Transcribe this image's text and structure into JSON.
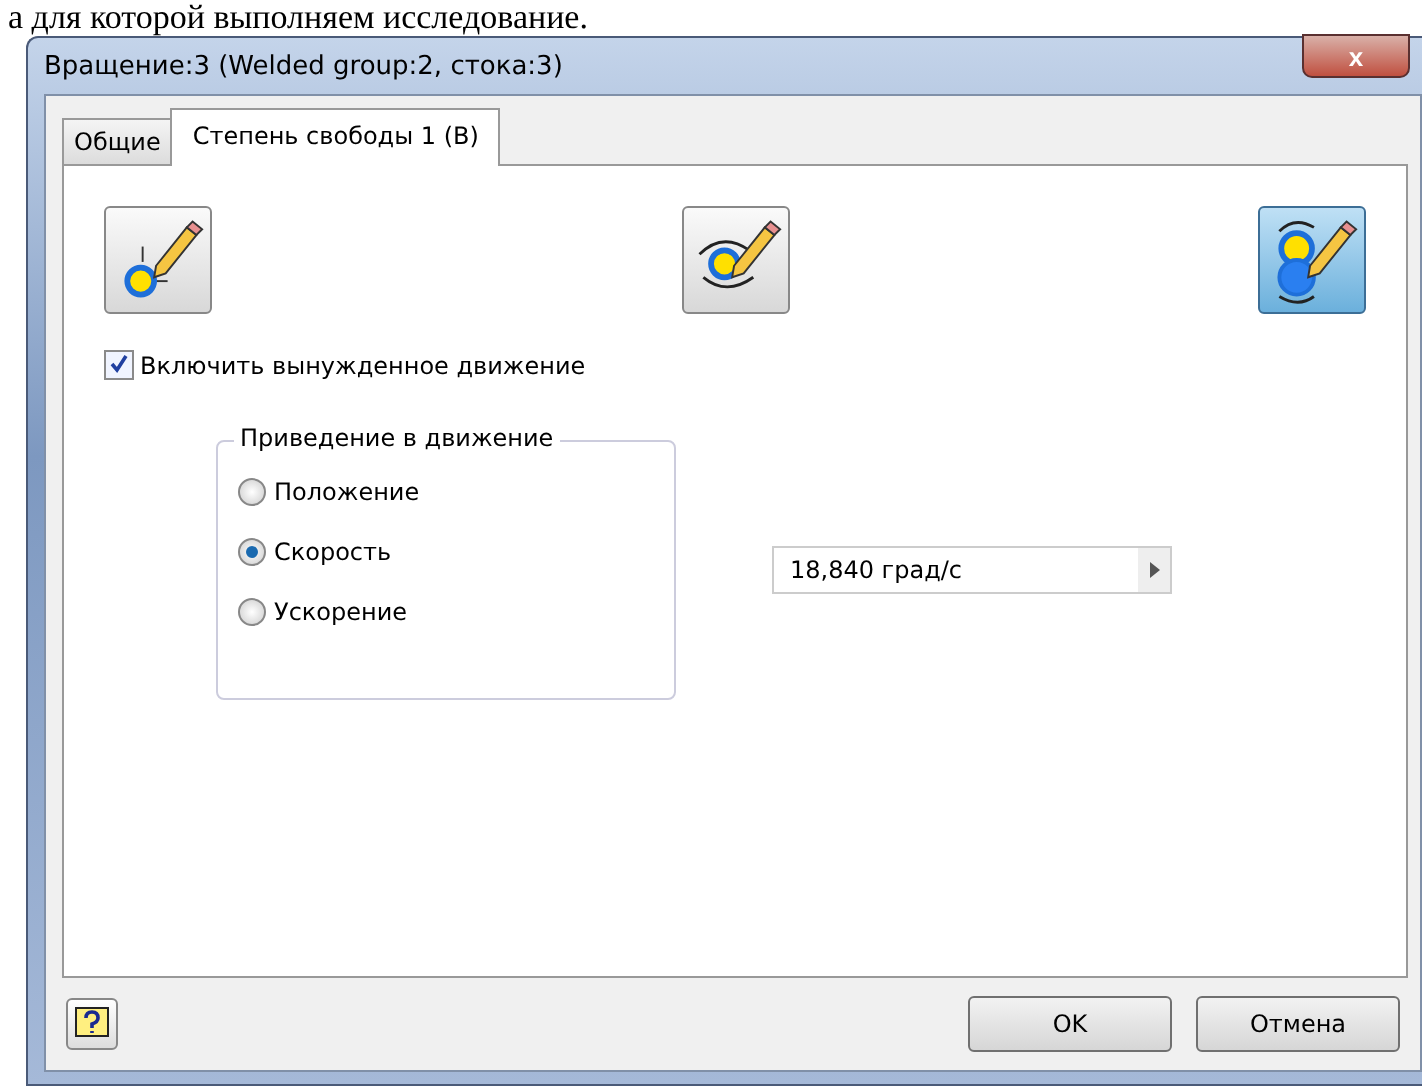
{
  "document_text": "а для которой выполняем исследование.",
  "window": {
    "title": "Вращение:3 (Welded group:2, стока:3)",
    "close": "x"
  },
  "tabs": [
    {
      "label": "Общие",
      "selected": false
    },
    {
      "label": "Степень свободы 1 (В)",
      "selected": true
    }
  ],
  "mode_buttons": [
    {
      "kind": "fixed",
      "selected": false
    },
    {
      "kind": "free",
      "selected": false
    },
    {
      "kind": "driven",
      "selected": true
    }
  ],
  "enable_motion": {
    "label": "Включить вынужденное движение",
    "checked": true
  },
  "drive_group": {
    "title": "Приведение в движение",
    "options": [
      {
        "label": "Положение",
        "selected": false
      },
      {
        "label": "Скорость",
        "selected": true
      },
      {
        "label": "Ускорение",
        "selected": false
      }
    ]
  },
  "value_field": {
    "value": "18,840 град/с"
  },
  "buttons": [
    {
      "label": "OK"
    },
    {
      "label": "Отмена"
    }
  ]
}
